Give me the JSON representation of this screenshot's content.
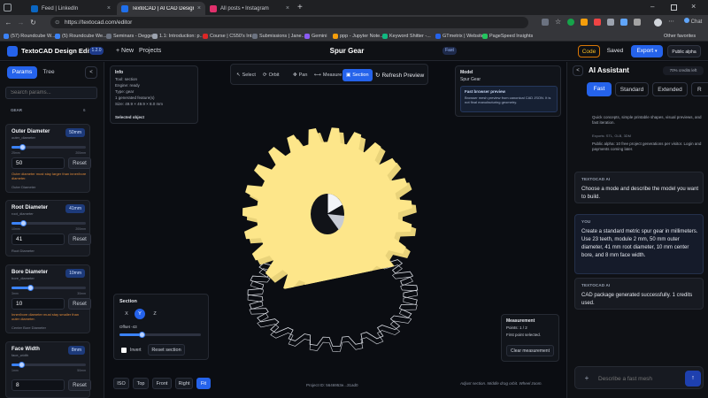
{
  "browser": {
    "tabs": [
      {
        "title": "Feed | LinkedIn",
        "color": "#0a66c2"
      },
      {
        "title": "(5) Roundcube We...",
        "color": "#3b82f6"
      },
      {
        "title": "TextoCAD | AI CAD Design Engine",
        "color": "#1f6feb"
      },
      {
        "title": "All posts • Instagram",
        "color": "#e1306c"
      }
    ],
    "new_tab": "+",
    "url": "https://textocad.com/editor",
    "chat_label": "Chat",
    "bookmarks": [
      {
        "label": "(57) Roundcube W...",
        "color": "#3b82f6"
      },
      {
        "label": "(5) Roundcube We...",
        "color": "#3b82f6"
      },
      {
        "label": "Seminars - Degge...",
        "color": "#6b7280"
      },
      {
        "label": "1.1: Introduction: p...",
        "color": "#9ca3af"
      },
      {
        "label": "Course | CS50's Int...",
        "color": "#dc2626"
      },
      {
        "label": "Submissions | Jane...",
        "color": "#6b7280"
      },
      {
        "label": "Gemini",
        "color": "#8b5cf6"
      },
      {
        "label": "ppp - Jupyter Note...",
        "color": "#f59e0b"
      },
      {
        "label": "Keyword Shitter -...",
        "color": "#10b981"
      },
      {
        "label": "GTmetrix | Website...",
        "color": "#2563eb"
      },
      {
        "label": "PageSpeed Insights",
        "color": "#22c55e"
      }
    ],
    "other_favorites": "Other favorites"
  },
  "app": {
    "brand": "TextoCAD Design Editor",
    "version": "1.2.0",
    "new_label": "+ New",
    "projects_label": "Projects",
    "doc_title": "Spur Gear",
    "mode_chip": "Fast",
    "code_label": "Code",
    "saved_label": "Saved",
    "export_label": "Export",
    "alpha_label": "Public alpha"
  },
  "left": {
    "tab_params": "Params",
    "tab_tree": "Tree",
    "collapse": "<",
    "search_placeholder": "Search params...",
    "section_label": "GEAR",
    "section_count": "6",
    "params": [
      {
        "title": "Outer Diameter",
        "sub": "outer_diameter",
        "badge": "50mm",
        "min": "25mm",
        "max": "200mm",
        "value": "50",
        "reset": "Reset",
        "note": "Outer diameter must stay larger than inner/bore diameter.",
        "desc": "Outer Diameter",
        "level": 0.15
      },
      {
        "title": "Root Diameter",
        "sub": "root_diameter",
        "badge": "41mm",
        "min": "10mm",
        "max": "200mm",
        "value": "41",
        "reset": "Reset",
        "note": "",
        "desc": "Root Diameter",
        "level": 0.16
      },
      {
        "title": "Bore Diameter",
        "sub": "bore_diameter",
        "badge": "10mm",
        "min": "3mm",
        "max": "30mm",
        "value": "10",
        "reset": "Reset",
        "note": "Inner/bore diameter must stay smaller than outer diameter.",
        "desc": "Center Bore Diameter",
        "level": 0.26
      },
      {
        "title": "Face Width",
        "sub": "face_width",
        "badge": "8mm",
        "min": "1mm",
        "max": "50mm",
        "value": "8",
        "reset": "Reset",
        "note": "",
        "desc": "",
        "level": 0.14
      }
    ]
  },
  "viewport": {
    "info": {
      "title": "Info",
      "rows": [
        "Tool: section",
        "Engine: ready",
        "Type: gear",
        "1 generated feature(s)",
        "Size: 49.9 × 49.9 × 8.0 mm"
      ],
      "selected": "Selected object"
    },
    "toolbar": [
      "Select",
      "Orbit",
      "Pan",
      "Measure",
      "Section"
    ],
    "toolbar_active": "Section",
    "refresh": "Refresh Preview",
    "model": {
      "label": "Model",
      "name": "Spur Gear",
      "preview_title": "Fast browser preview",
      "preview_text": "Browser mesh preview from canonical CAD JSON. It is not final manufacturing geometry."
    },
    "section": {
      "title": "Section",
      "axes": [
        "X",
        "Y",
        "Z"
      ],
      "active_axis": "Y",
      "offset": "Offset -43",
      "offset_level": 0.28,
      "invert": "Invert",
      "reset": "Reset section"
    },
    "measurement": {
      "title": "Measurement",
      "points": "Points: 1 / 2",
      "status": "First point selected.",
      "clear": "Clear measurement"
    },
    "views": [
      "ISO",
      "Top",
      "Front",
      "Right",
      "Fit"
    ],
    "active_view": "Fit",
    "project_id": "Project ID: 5646953e...31ad0",
    "hint": "Adjust section. Middle drag orbit. Wheel zoom.",
    "colors": {
      "gear_face": "#fde68a",
      "gear_side": "#e9d37a",
      "wire": "#d9dce3"
    }
  },
  "assistant": {
    "collapse": "<",
    "title": "AI Assistant",
    "credits": "70% credits left",
    "modes": [
      "Fast",
      "Standard",
      "Extended",
      "R"
    ],
    "active_mode": "Fast",
    "mode_desc": "Quick concepts, simple printable shapes, visual previews, and fast iteration.",
    "exports": "Exports: STL, GLB, 3DM",
    "alpha_note": "Public alpha: 10 free project generations per visitor. Login and payments coming later.",
    "messages": [
      {
        "who": "TEXTOCAD AI",
        "text": "Choose a mode and describe the model you want to build."
      },
      {
        "who": "YOU",
        "text": "Create a standard metric spur gear in millimeters. Use 23 teeth, module 2 mm, 50 mm outer diameter, 41 mm root diameter, 10 mm center bore, and 8 mm face width."
      },
      {
        "who": "TEXTOCAD AI",
        "text": "CAD package generated successfully. 1 credits used."
      }
    ],
    "input_placeholder": "Describe a fast mesh",
    "attach": "+",
    "send": "↑"
  }
}
